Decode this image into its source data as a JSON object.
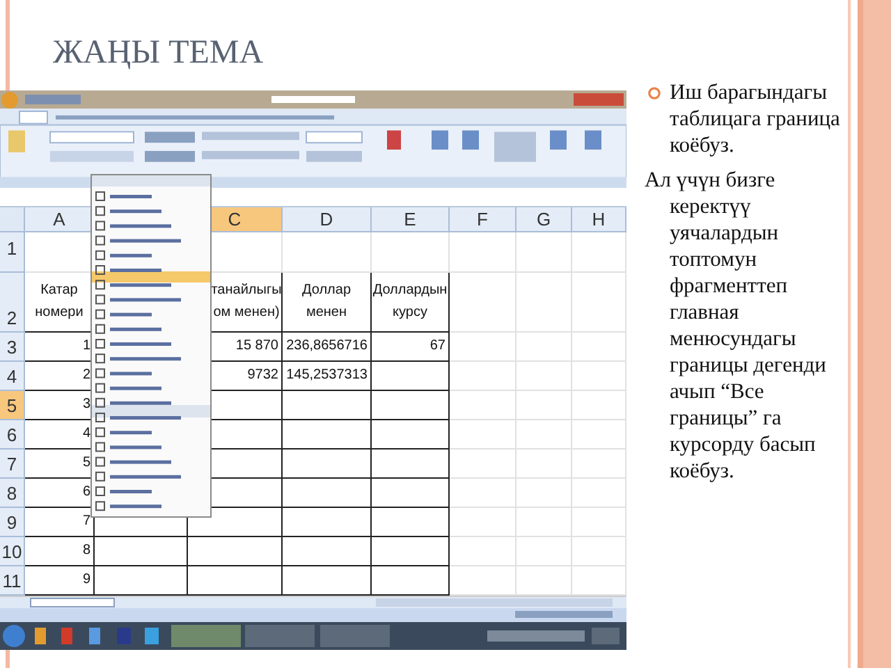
{
  "slide": {
    "title": "ЖАҢЫ ТЕМА",
    "paragraphs": [
      {
        "kind": "bullet",
        "text": "Иш барагындагы таблицага граница коёбуз."
      },
      {
        "kind": "plain",
        "text": "Ал үчүн бизге керектүү уячалардын топтомун фрагменттеп главная менюсундагы границы дегенди ачып “Все границы”  га курсорду басып коёбуз."
      }
    ]
  },
  "spreadsheet": {
    "columns": [
      {
        "label": "A",
        "selected": false
      },
      {
        "label": "C",
        "selected": true
      },
      {
        "label": "D",
        "selected": false
      },
      {
        "label": "E",
        "selected": false
      },
      {
        "label": "F",
        "selected": false
      },
      {
        "label": "G",
        "selected": false
      },
      {
        "label": "H",
        "selected": false
      }
    ],
    "rows": [
      {
        "label": "1",
        "selected": false,
        "kind": "blank"
      },
      {
        "label": "2",
        "selected": false,
        "kind": "header",
        "a": "Катар\nномери",
        "c": "танайлыгы\nом менен)",
        "d": "Доллар\nменен",
        "e": "Доллардын\nкурсу"
      },
      {
        "label": "3",
        "selected": false,
        "kind": "data",
        "a": "1",
        "c": "15 870",
        "d": "236,8656716",
        "e": "67"
      },
      {
        "label": "4",
        "selected": false,
        "kind": "data",
        "a": "2",
        "c": "9732",
        "d": "145,2537313"
      },
      {
        "label": "5",
        "selected": true,
        "kind": "data",
        "a": "3"
      },
      {
        "label": "6",
        "selected": false,
        "kind": "data",
        "a": "4"
      },
      {
        "label": "7",
        "selected": false,
        "kind": "data",
        "a": "5"
      },
      {
        "label": "8",
        "selected": false,
        "kind": "data",
        "a": "6"
      },
      {
        "label": "9",
        "selected": false,
        "kind": "data",
        "a": "7"
      },
      {
        "label": "10",
        "selected": false,
        "kind": "data",
        "a": "8"
      },
      {
        "label": "11",
        "selected": false,
        "kind": "data",
        "a": "9"
      }
    ]
  }
}
